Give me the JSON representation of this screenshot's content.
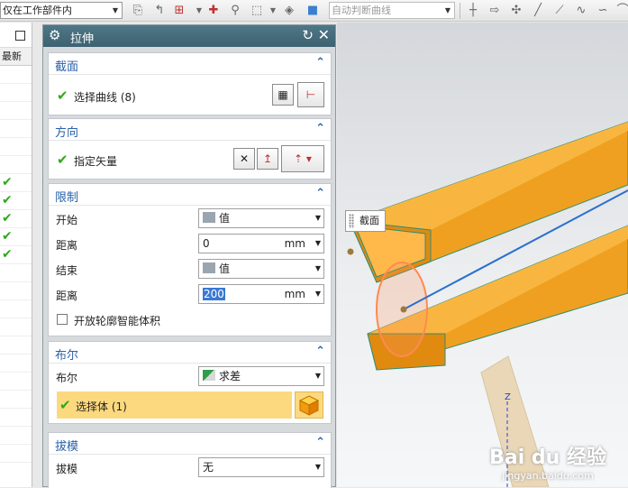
{
  "toolbar": {
    "filter_combo": "仅在工作部件内",
    "curve_rule_combo": "自动判断曲线"
  },
  "navigator": {
    "column_header": "最新",
    "checked_rows": [
      7,
      8,
      9,
      10,
      11
    ]
  },
  "dialog": {
    "title": "拉伸",
    "section_section": {
      "title": "截面",
      "select_curve_label": "选择曲线 (8)"
    },
    "direction_section": {
      "title": "方向",
      "specify_vector_label": "指定矢量"
    },
    "limits_section": {
      "title": "限制",
      "start_label": "开始",
      "start_value": "值",
      "start_distance_label": "距离",
      "start_distance_value": "0",
      "start_distance_unit": "mm",
      "end_label": "结束",
      "end_value": "值",
      "end_distance_label": "距离",
      "end_distance_value": "200",
      "end_distance_unit": "mm",
      "open_profile_label": "开放轮廓智能体积"
    },
    "boolean_section": {
      "title": "布尔",
      "boolean_label": "布尔",
      "boolean_value": "求差",
      "select_body_label": "选择体 (1)"
    },
    "draft_section": {
      "title": "拔模",
      "draft_label": "拔模",
      "draft_value": "无"
    }
  },
  "viewport": {
    "tooltip": "截面",
    "axis_label": "Z",
    "watermark_main": "Bai du 经验",
    "watermark_sub": "jingyan.baidu.com"
  },
  "colors": {
    "section_title": "#2a62a8",
    "dialog_titlebar": "#46707f",
    "tube_orange": "#f5a623",
    "check_green": "#2eaa1a"
  }
}
